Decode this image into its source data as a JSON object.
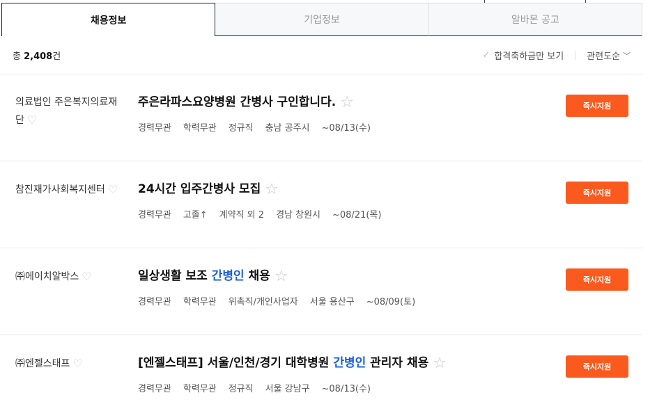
{
  "tabs": [
    {
      "label": "채용정보",
      "active": true
    },
    {
      "label": "기업정보",
      "active": false
    },
    {
      "label": "알바몬 공고",
      "active": false
    }
  ],
  "summary": {
    "prefix": "총",
    "count": "2,408",
    "suffix": "건"
  },
  "filters": {
    "passed_only": "합격축하금만 보기",
    "sort": "관련도순"
  },
  "apply_label": "즉시지원",
  "jobs": [
    {
      "company": "의료법인 주은복지의료재단",
      "title_pre": "주은라파스요양병원 간병사 구인합니다.",
      "title_hl": "",
      "title_post": "",
      "meta": [
        "경력무관",
        "학력무관",
        "정규직",
        "충남 공주시",
        "~08/13(수)"
      ]
    },
    {
      "company": "참진재가사회복지센터",
      "title_pre": "24시간 입주간병사 모집",
      "title_hl": "",
      "title_post": "",
      "meta": [
        "경력무관",
        "고졸↑",
        "계약직 외 2",
        "경남 창원시",
        "~08/21(목)"
      ]
    },
    {
      "company": "㈜에이치알박스",
      "title_pre": "일상생활 보조 ",
      "title_hl": "간병인",
      "title_post": " 채용",
      "meta": [
        "경력무관",
        "학력무관",
        "위촉직/개인사업자",
        "서울 용산구",
        "~08/09(토)"
      ]
    },
    {
      "company": "㈜엔젤스태프",
      "title_pre": "[엔젤스태프] 서울/인천/경기 대학병원 ",
      "title_hl": "간병인",
      "title_post": " 관리자 채용",
      "meta": [
        "경력무관",
        "학력무관",
        "정규직",
        "서울 강남구",
        "~08/13(수)"
      ]
    }
  ],
  "colors": {
    "accent": "#fa5a1e",
    "highlight": "#1a5ed8"
  },
  "icons": {
    "heart": "heart-icon",
    "star": "star-icon",
    "check": "check-icon",
    "chevron": "chevron-down-icon"
  }
}
